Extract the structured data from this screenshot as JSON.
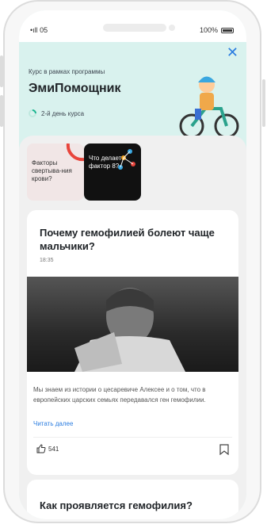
{
  "status_bar": {
    "carrier": "•ıll 05",
    "wifi": "wifi-icon",
    "battery": "100%"
  },
  "header": {
    "subtitle": "Курс в рамках программы",
    "title": "ЭмиПомощник",
    "day": "2-й день курса",
    "close_icon": "close-icon",
    "accent": "#2b7de0",
    "bg": "#d9f2ee"
  },
  "stories": [
    {
      "label": "Факторы свертыва-ния крови?"
    },
    {
      "label": "Что делает фактор 8?"
    }
  ],
  "article": {
    "title": "Почему гемофилией болеют чаще мальчики?",
    "time": "18:35",
    "text": "Мы знаем из истории о цесаревиче Алексее и о том, что в европейских царских семьях передавался ген гемофилии.",
    "read_more": "Читать далее",
    "likes": "541"
  },
  "article2": {
    "title": "Как проявляется гемофилия?"
  }
}
